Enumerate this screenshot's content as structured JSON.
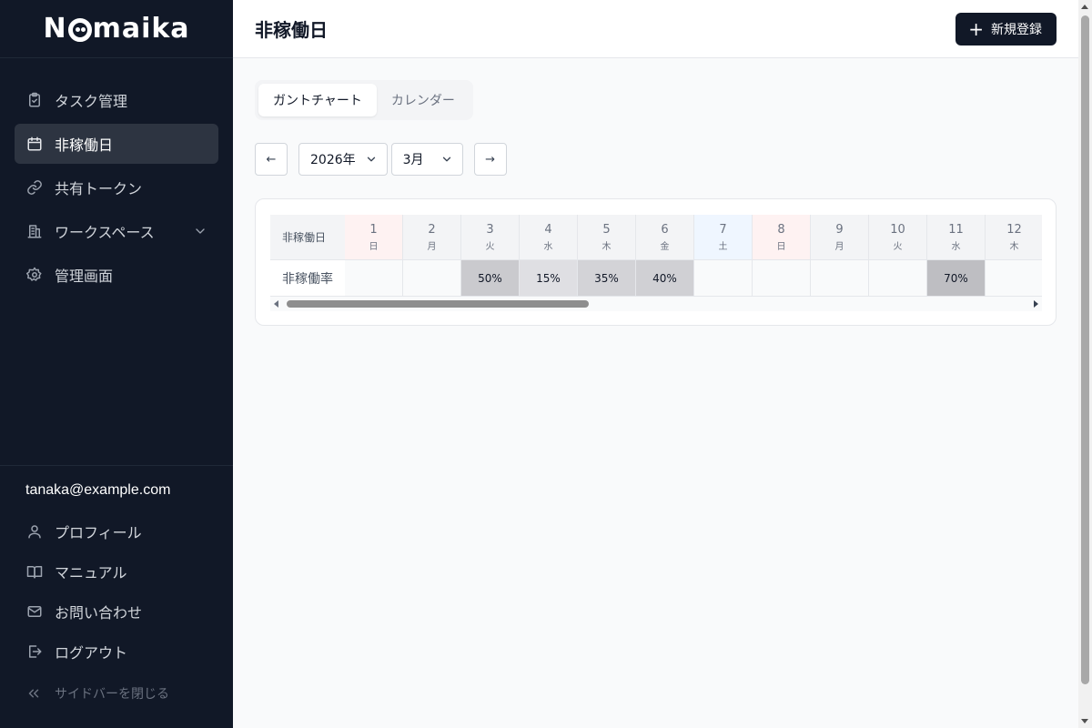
{
  "app": {
    "logo_text_start": "N",
    "logo_text_end": "maika"
  },
  "sidebar": {
    "items": [
      {
        "label": "タスク管理",
        "icon": "clipboard-check-icon"
      },
      {
        "label": "非稼働日",
        "icon": "calendar-icon",
        "active": true
      },
      {
        "label": "共有トークン",
        "icon": "link-icon"
      },
      {
        "label": "ワークスペース",
        "icon": "building-icon",
        "has_submenu": true
      },
      {
        "label": "管理画面",
        "icon": "gear-icon"
      }
    ],
    "user_email": "tanaka@example.com",
    "bottom_items": [
      {
        "label": "プロフィール",
        "icon": "user-icon"
      },
      {
        "label": "マニュアル",
        "icon": "book-icon"
      },
      {
        "label": "お問い合わせ",
        "icon": "mail-icon"
      },
      {
        "label": "ログアウト",
        "icon": "logout-icon"
      }
    ],
    "collapse_label": "サイドバーを閉じる"
  },
  "header": {
    "title": "非稼働日",
    "new_button_label": "新規登録"
  },
  "tabs": [
    {
      "label": "ガントチャート",
      "active": true
    },
    {
      "label": "カレンダー",
      "active": false
    }
  ],
  "controls": {
    "prev_label": "←",
    "next_label": "→",
    "year": "2026年",
    "month": "3月"
  },
  "table": {
    "header_label": "非稼働日",
    "row_label": "非稼働率",
    "days": [
      {
        "day": "1",
        "weekday": "日",
        "type": "sun",
        "value": ""
      },
      {
        "day": "2",
        "weekday": "月",
        "type": "",
        "value": ""
      },
      {
        "day": "3",
        "weekday": "火",
        "type": "",
        "value": "50%",
        "level": 0.5
      },
      {
        "day": "4",
        "weekday": "水",
        "type": "",
        "value": "15%",
        "level": 0.15
      },
      {
        "day": "5",
        "weekday": "木",
        "type": "",
        "value": "35%",
        "level": 0.35
      },
      {
        "day": "6",
        "weekday": "金",
        "type": "",
        "value": "40%",
        "level": 0.4
      },
      {
        "day": "7",
        "weekday": "土",
        "type": "sat",
        "value": ""
      },
      {
        "day": "8",
        "weekday": "日",
        "type": "sun",
        "value": ""
      },
      {
        "day": "9",
        "weekday": "月",
        "type": "",
        "value": ""
      },
      {
        "day": "10",
        "weekday": "火",
        "type": "",
        "value": ""
      },
      {
        "day": "11",
        "weekday": "水",
        "type": "",
        "value": "70%",
        "level": 0.7
      },
      {
        "day": "12",
        "weekday": "木",
        "type": "",
        "value": ""
      }
    ]
  }
}
